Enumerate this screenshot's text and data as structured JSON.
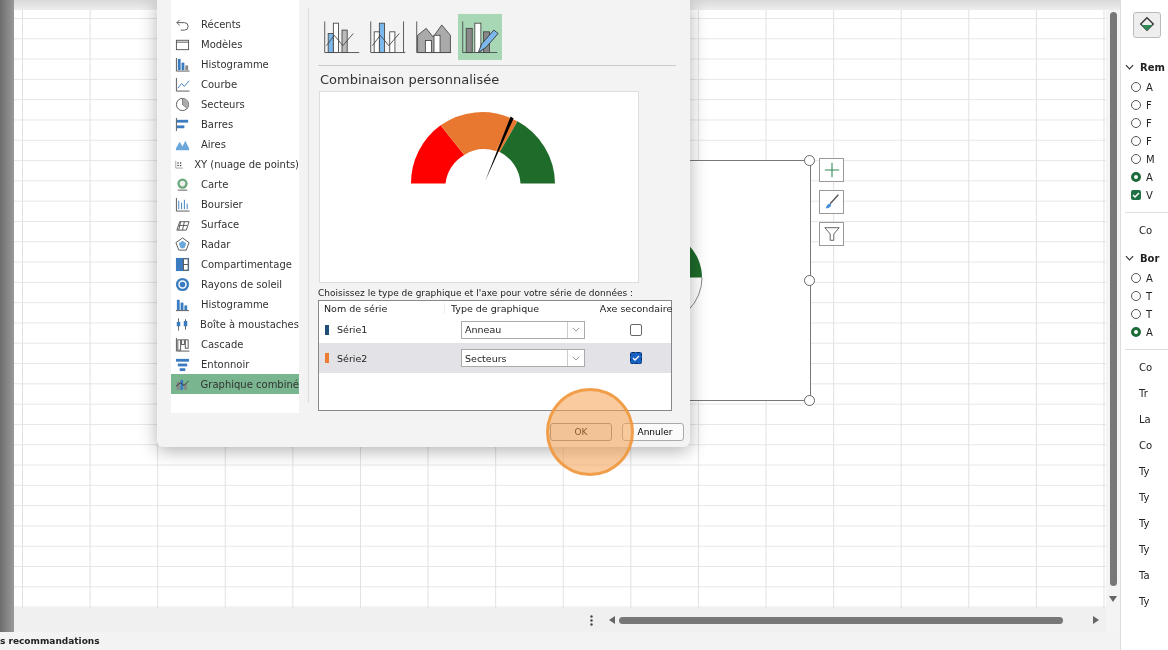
{
  "dialog": {
    "categories": [
      {
        "label": "Récents",
        "selected": false
      },
      {
        "label": "Modèles",
        "selected": false
      },
      {
        "label": "Histogramme",
        "selected": false
      },
      {
        "label": "Courbe",
        "selected": false
      },
      {
        "label": "Secteurs",
        "selected": false
      },
      {
        "label": "Barres",
        "selected": false
      },
      {
        "label": "Aires",
        "selected": false
      },
      {
        "label": "XY (nuage de points)",
        "selected": false
      },
      {
        "label": "Carte",
        "selected": false
      },
      {
        "label": "Boursier",
        "selected": false
      },
      {
        "label": "Surface",
        "selected": false
      },
      {
        "label": "Radar",
        "selected": false
      },
      {
        "label": "Compartimentage",
        "selected": false
      },
      {
        "label": "Rayons de soleil",
        "selected": false
      },
      {
        "label": "Histogramme",
        "selected": false
      },
      {
        "label": "Boîte à moustaches",
        "selected": false
      },
      {
        "label": "Cascade",
        "selected": false
      },
      {
        "label": "Entonnoir",
        "selected": false
      },
      {
        "label": "Graphique combiné",
        "selected": true
      }
    ],
    "subtypes": [
      {
        "selected": false
      },
      {
        "selected": false
      },
      {
        "selected": false
      },
      {
        "selected": true
      }
    ],
    "preview_title": "Combinaison personnalisée",
    "series_prompt": "Choisissez le type de graphique et l'axe pour votre série de données :",
    "series_table": {
      "columns": [
        "Nom de série",
        "Type de graphique",
        "Axe secondaire"
      ],
      "rows": [
        {
          "name": "Série1",
          "color": "#1f4e79",
          "chart_type": "Anneau",
          "secondary_axis": false,
          "selected": false
        },
        {
          "name": "Série2",
          "color": "#ed7d31",
          "chart_type": "Secteurs",
          "secondary_axis": true,
          "selected": true
        }
      ]
    },
    "buttons": [
      "OK",
      "Annuler"
    ]
  },
  "format_panel": {
    "rows": [
      {
        "kind": "header",
        "label": "Rem",
        "expanded": true
      },
      {
        "kind": "radio",
        "label": "A",
        "selected": false
      },
      {
        "kind": "radio",
        "label": "F",
        "selected": false
      },
      {
        "kind": "radio",
        "label": "F",
        "selected": false
      },
      {
        "kind": "radio",
        "label": "F",
        "selected": false
      },
      {
        "kind": "radio",
        "label": "M",
        "selected": false
      },
      {
        "kind": "radio",
        "label": "A",
        "selected": true
      },
      {
        "kind": "checkbox",
        "label": "V",
        "checked": true
      },
      {
        "kind": "divider"
      },
      {
        "kind": "text",
        "label": "Co"
      },
      {
        "kind": "header",
        "label": "Bor",
        "expanded": true
      },
      {
        "kind": "radio",
        "label": "A",
        "selected": false
      },
      {
        "kind": "radio",
        "label": "T",
        "selected": false
      },
      {
        "kind": "radio",
        "label": "T",
        "selected": false
      },
      {
        "kind": "radio",
        "label": "A",
        "selected": true
      },
      {
        "kind": "divider"
      },
      {
        "kind": "text",
        "label": "Co"
      },
      {
        "kind": "text",
        "label": "Tr"
      },
      {
        "kind": "text",
        "label": "La"
      },
      {
        "kind": "text",
        "label": "Co"
      },
      {
        "kind": "text",
        "label": "Ty"
      },
      {
        "kind": "text",
        "label": "Ty"
      },
      {
        "kind": "text",
        "label": "Ty"
      },
      {
        "kind": "text",
        "label": "Ty"
      },
      {
        "kind": "text",
        "label": "Ta"
      },
      {
        "kind": "text",
        "label": "Ty"
      }
    ]
  },
  "status_bar": {
    "text": "s recommandations"
  }
}
